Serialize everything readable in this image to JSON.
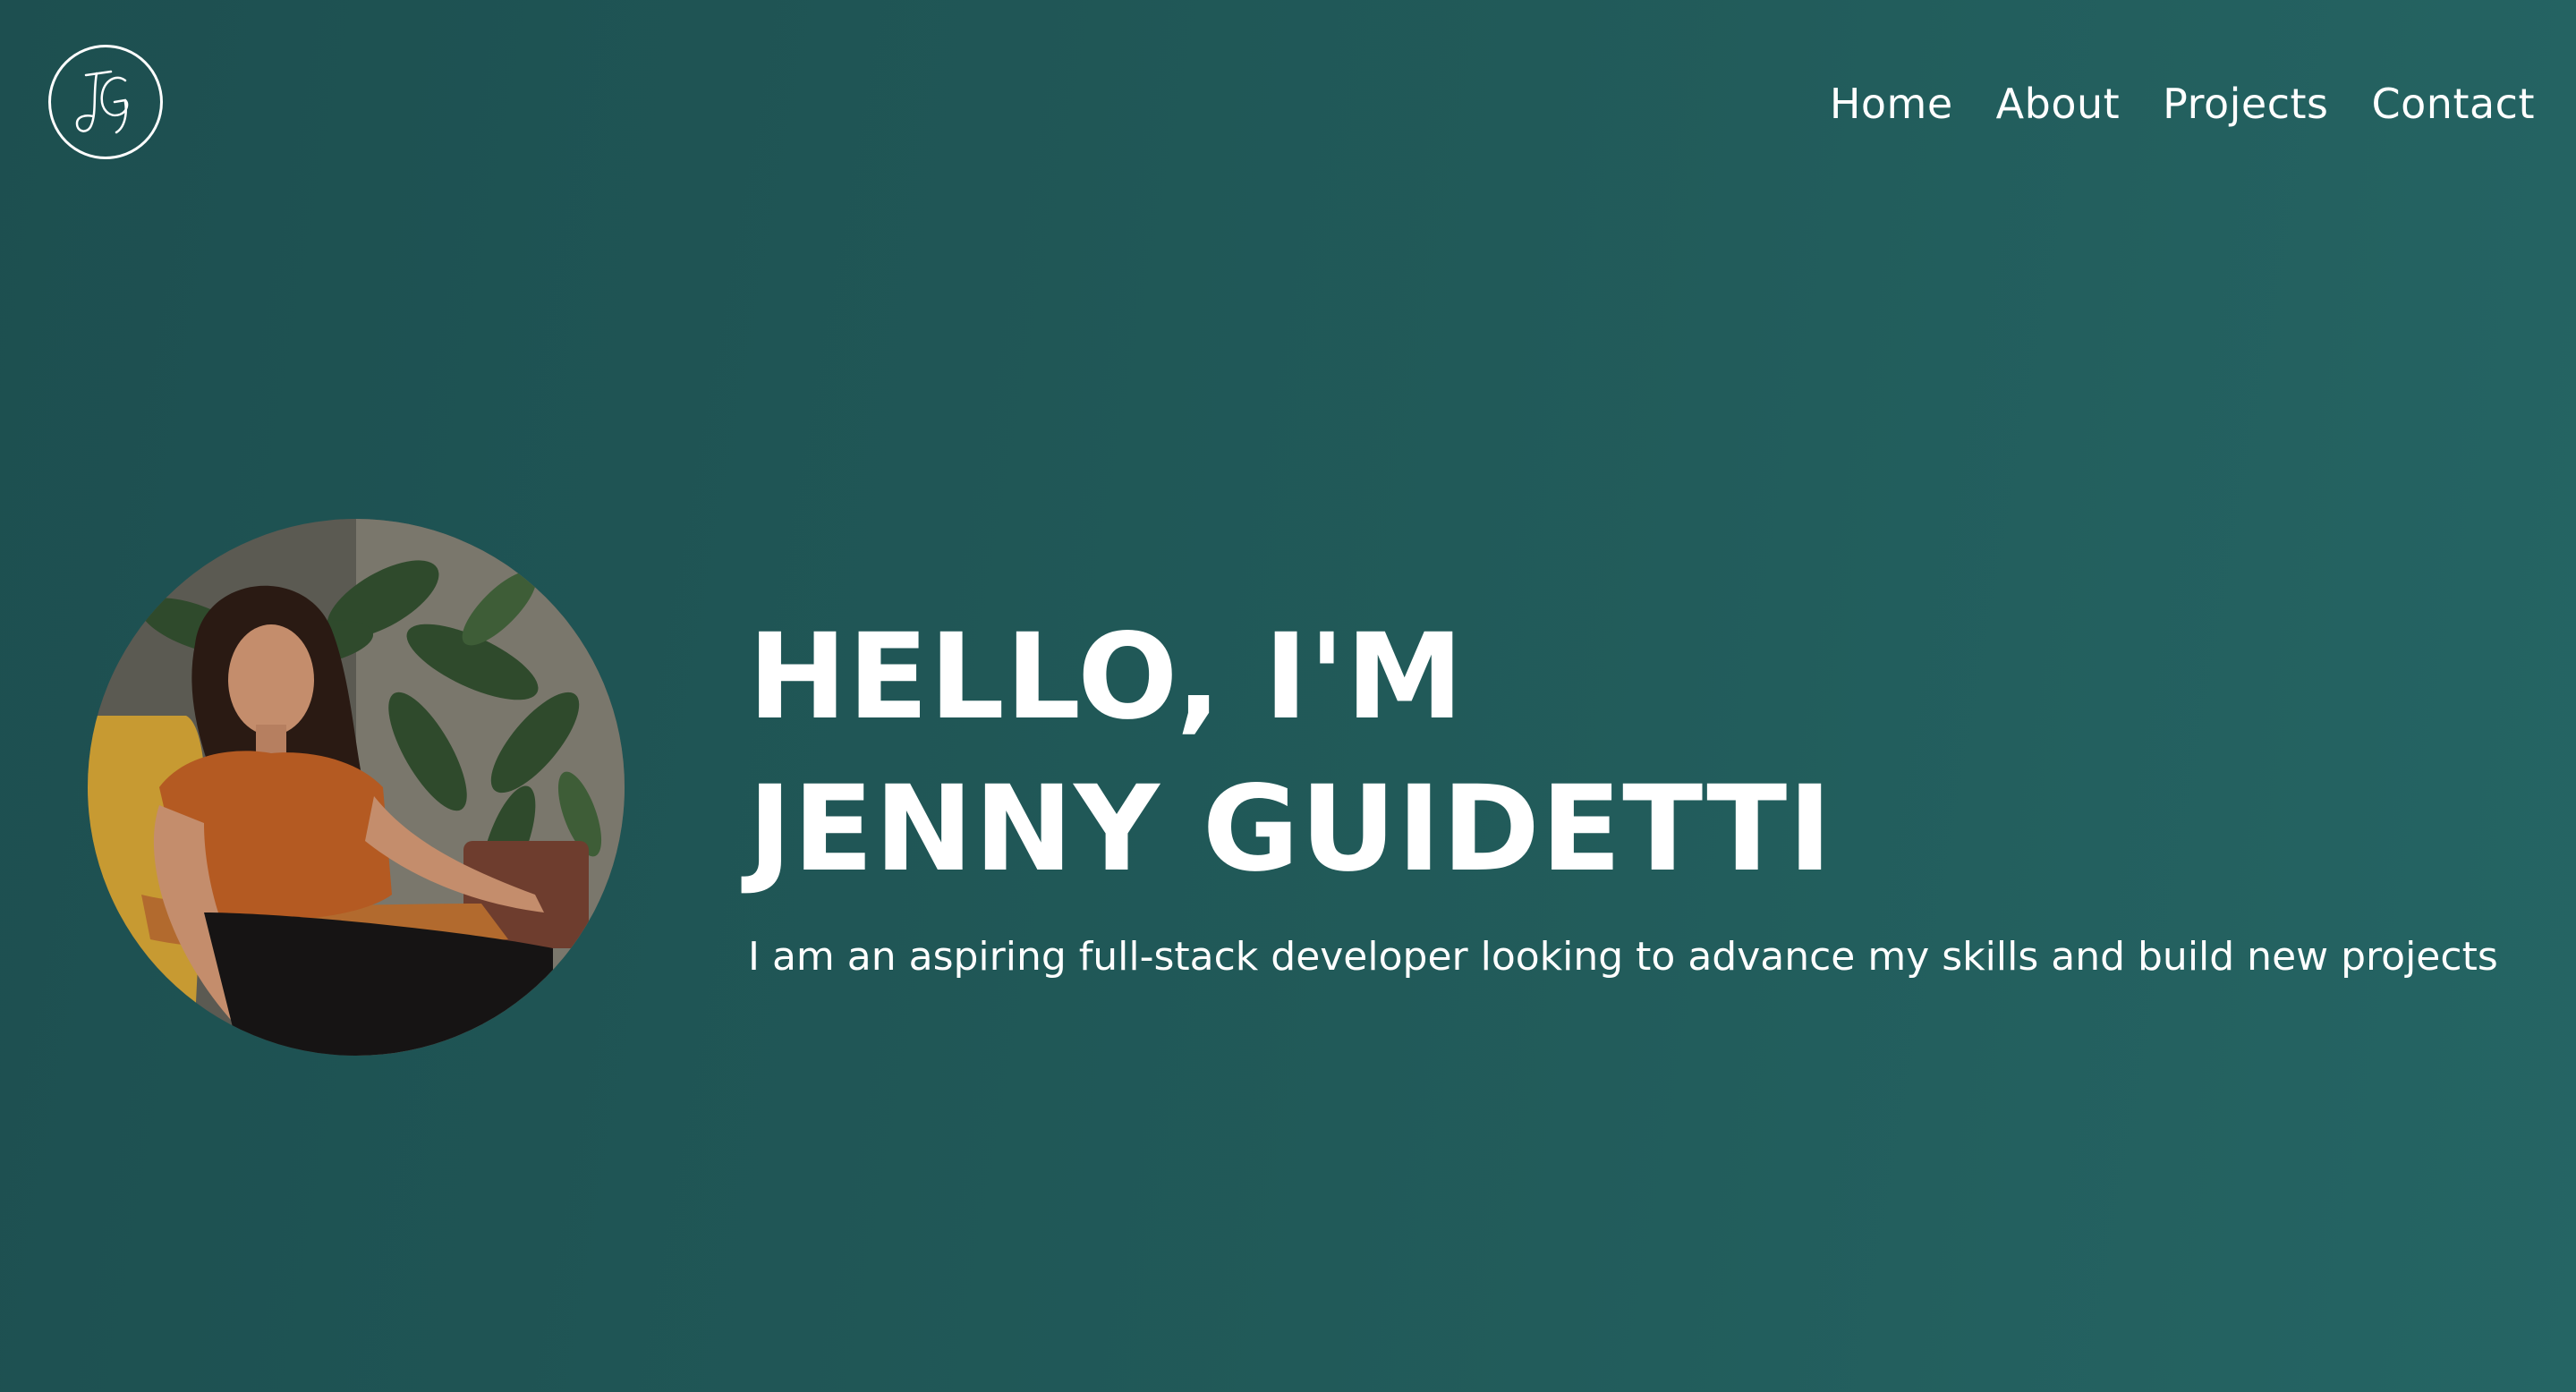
{
  "header": {
    "logo_text": "JG",
    "nav": [
      {
        "label": "Home"
      },
      {
        "label": "About"
      },
      {
        "label": "Projects"
      },
      {
        "label": "Contact"
      }
    ]
  },
  "hero": {
    "heading_line1": "HELLO, I'M",
    "heading_line2": "JENNY GUIDETTI",
    "subtitle": "I am an aspiring full-stack developer looking to advance my skills and build new projects",
    "photo_alt": "profile-photo"
  },
  "colors": {
    "background": "#215a59",
    "text": "#ffffff"
  }
}
